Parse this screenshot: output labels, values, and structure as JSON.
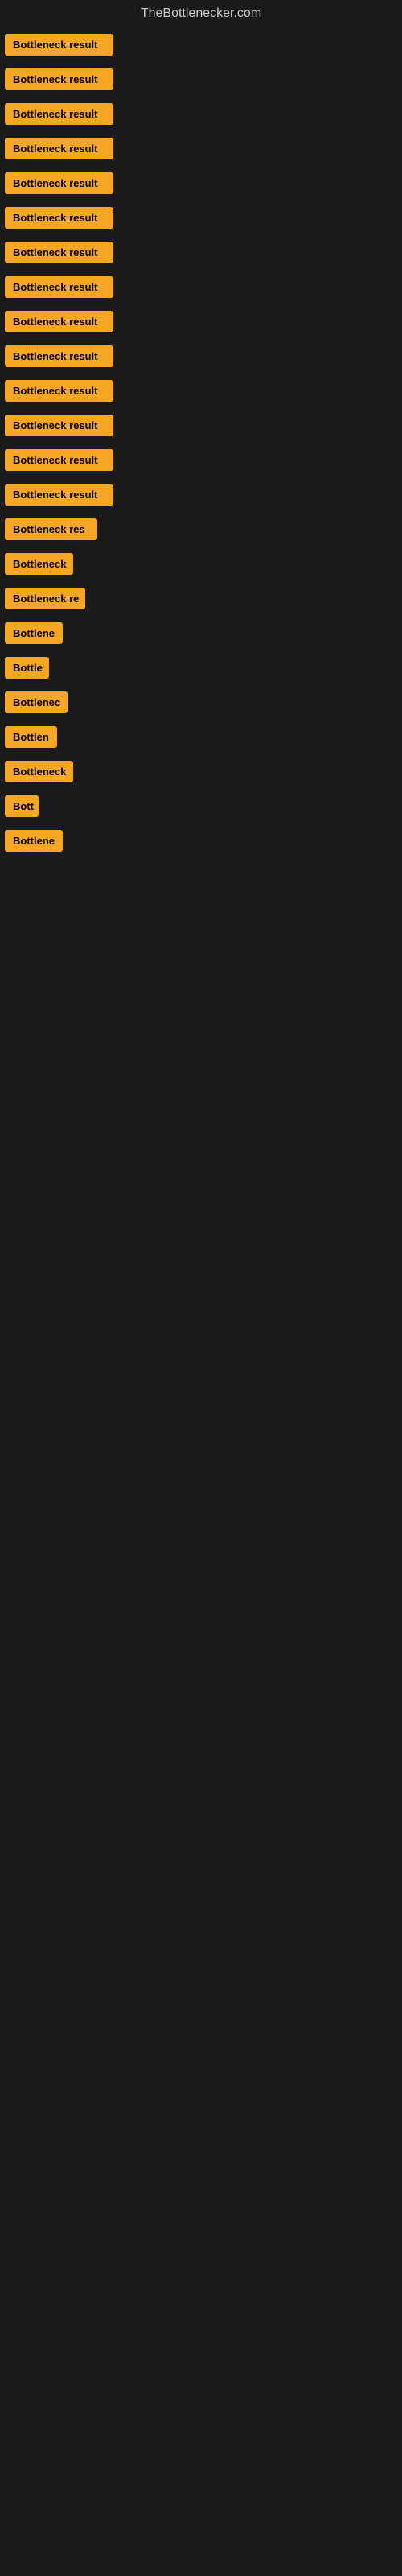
{
  "site": {
    "title": "TheBottlenecker.com"
  },
  "rows": [
    {
      "label": "Bottleneck result",
      "width": 135
    },
    {
      "label": "Bottleneck result",
      "width": 135
    },
    {
      "label": "Bottleneck result",
      "width": 135
    },
    {
      "label": "Bottleneck result",
      "width": 135
    },
    {
      "label": "Bottleneck result",
      "width": 135
    },
    {
      "label": "Bottleneck result",
      "width": 135
    },
    {
      "label": "Bottleneck result",
      "width": 135
    },
    {
      "label": "Bottleneck result",
      "width": 135
    },
    {
      "label": "Bottleneck result",
      "width": 135
    },
    {
      "label": "Bottleneck result",
      "width": 135
    },
    {
      "label": "Bottleneck result",
      "width": 135
    },
    {
      "label": "Bottleneck result",
      "width": 135
    },
    {
      "label": "Bottleneck result",
      "width": 135
    },
    {
      "label": "Bottleneck result",
      "width": 135
    },
    {
      "label": "Bottleneck res",
      "width": 115
    },
    {
      "label": "Bottleneck",
      "width": 85
    },
    {
      "label": "Bottleneck re",
      "width": 100
    },
    {
      "label": "Bottlene",
      "width": 72
    },
    {
      "label": "Bottle",
      "width": 55
    },
    {
      "label": "Bottlenec",
      "width": 78
    },
    {
      "label": "Bottlen",
      "width": 65
    },
    {
      "label": "Bottleneck",
      "width": 85
    },
    {
      "label": "Bott",
      "width": 42
    },
    {
      "label": "Bottlene",
      "width": 72
    }
  ],
  "colors": {
    "bar_bg": "#f5a623",
    "bar_text": "#000000",
    "page_bg": "#1a1a1a",
    "title_text": "#cccccc"
  }
}
